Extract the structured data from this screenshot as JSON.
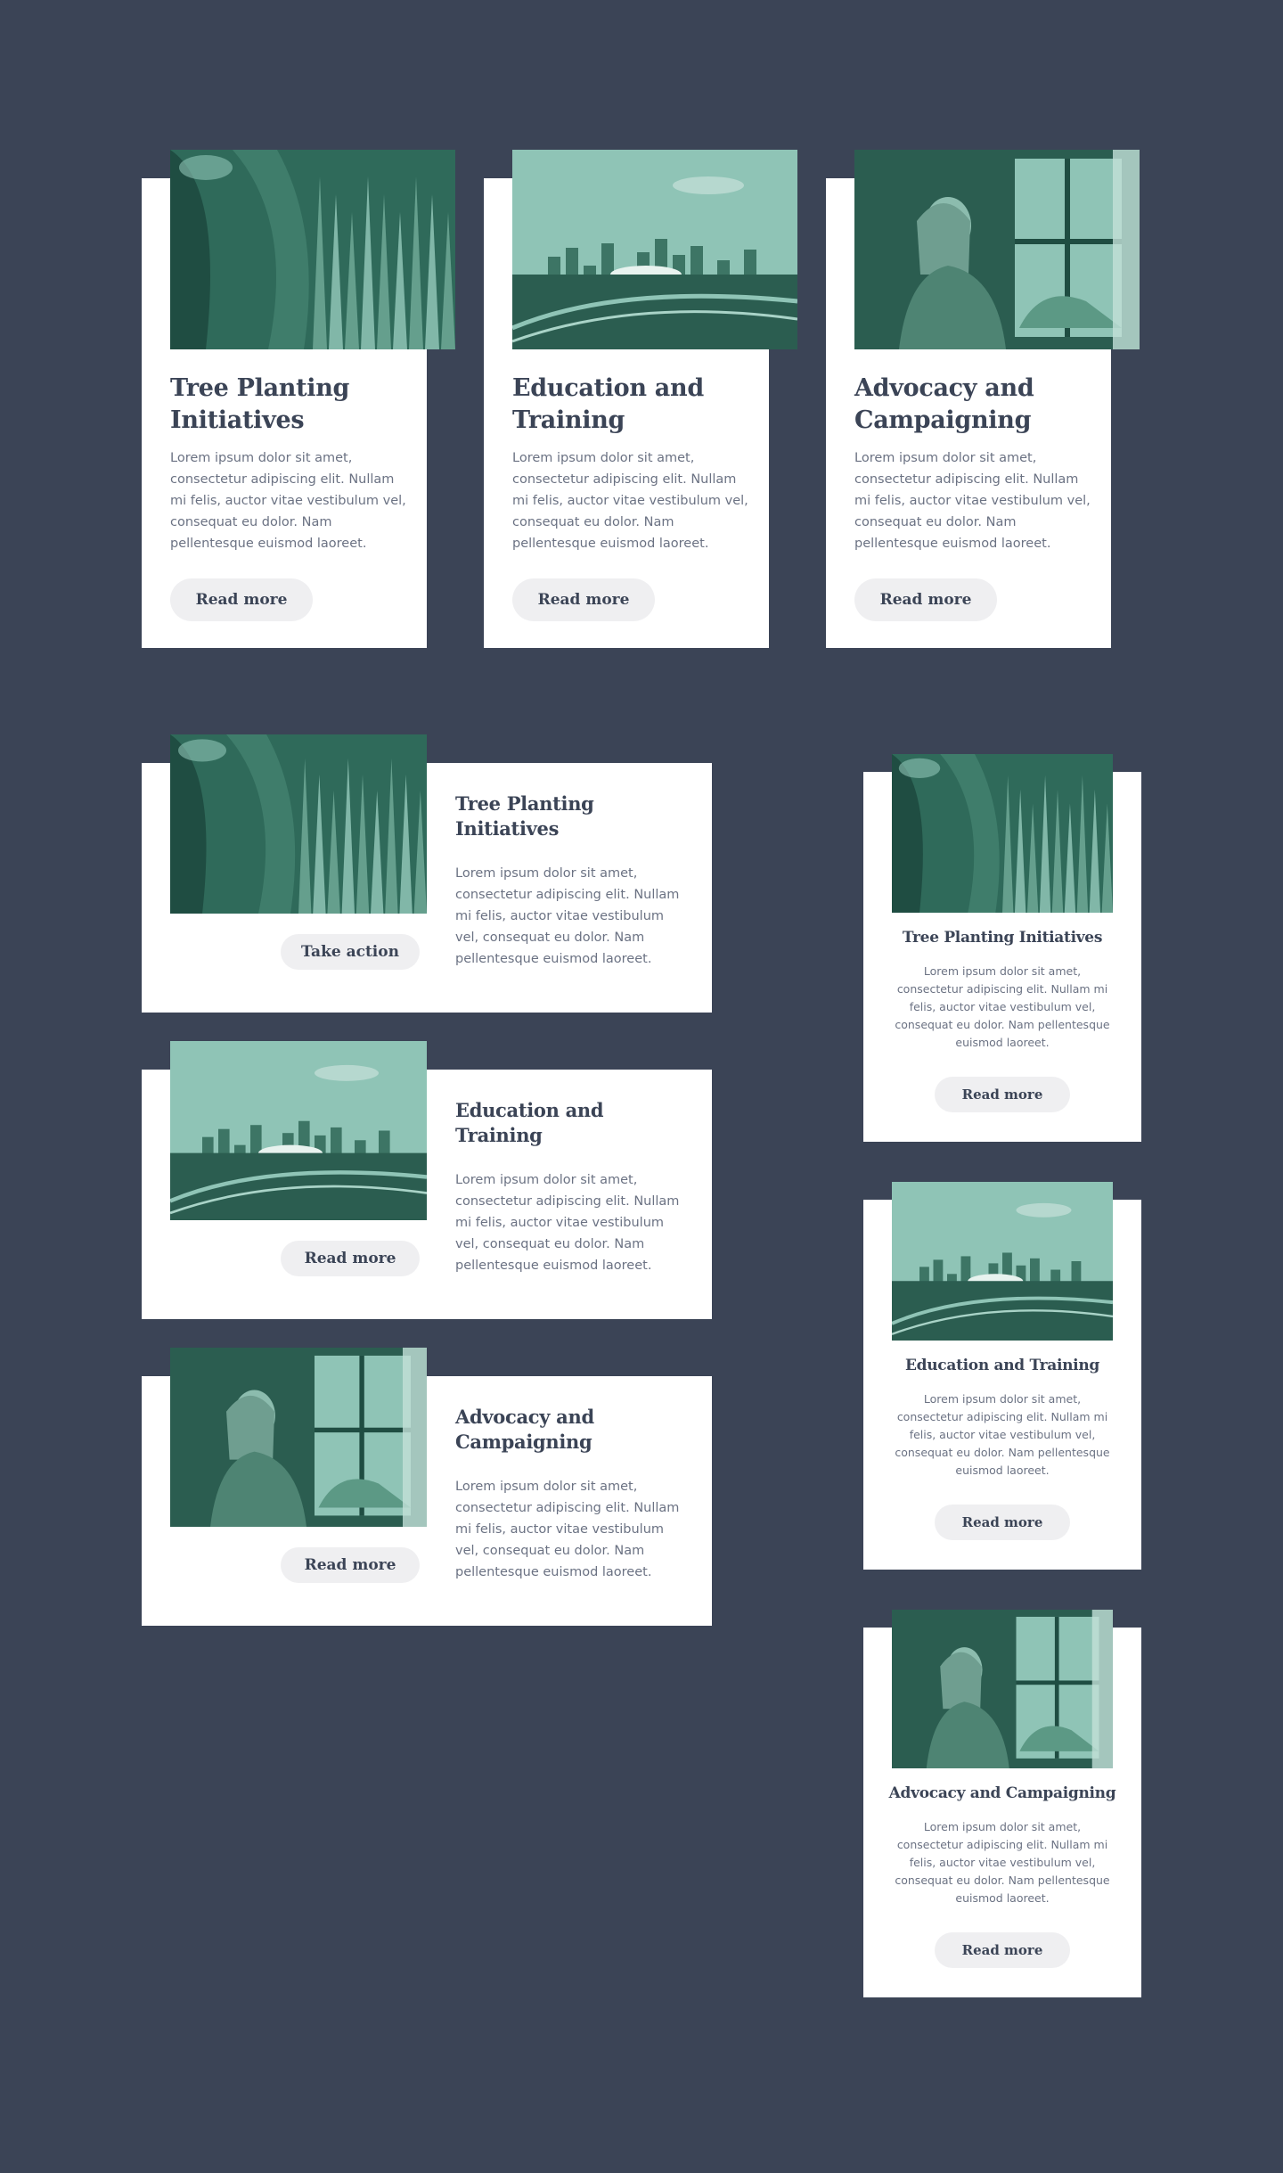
{
  "colors": {
    "page_background": "#3b4456",
    "card_background": "#ffffff",
    "heading_text": "#3b4456",
    "body_text": "#6b7283",
    "button_background": "#efeff1",
    "photo_tint_dark": "#1f4d42",
    "photo_tint_light": "#8fc4b6"
  },
  "top_row": {
    "cards": [
      {
        "image_icon": "plant-photo",
        "title": "Tree Planting Initiatives",
        "body": "Lorem ipsum dolor sit amet, consectetur adipiscing elit. Nullam mi felis, auctor vitae vestibulum vel, consequat eu dolor. Nam pellentesque euismod laoreet.",
        "button": "Read more"
      },
      {
        "image_icon": "city-skyline-photo",
        "title": "Education and Training",
        "body": "Lorem ipsum dolor sit amet, consectetur adipiscing elit. Nullam mi felis, auctor vitae vestibulum vel, consequat eu dolor. Nam pellentesque euismod laoreet.",
        "button": "Read more"
      },
      {
        "image_icon": "woman-window-photo",
        "title": "Advocacy and Campaigning",
        "body": "Lorem ipsum dolor sit amet, consectetur adipiscing elit. Nullam mi felis, auctor vitae vestibulum vel, consequat eu dolor. Nam pellentesque euismod laoreet.",
        "button": "Read more"
      }
    ]
  },
  "horizontal_list": {
    "cards": [
      {
        "image_icon": "plant-photo",
        "title": "Tree Planting Initiatives",
        "body": "Lorem ipsum dolor sit amet, consectetur adipiscing elit. Nullam mi felis, auctor vitae vestibulum vel, consequat eu dolor. Nam pellentesque euismod laoreet.",
        "button": "Take action"
      },
      {
        "image_icon": "city-skyline-photo",
        "title": "Education and Training",
        "body": "Lorem ipsum dolor sit amet, consectetur adipiscing elit. Nullam mi felis, auctor vitae vestibulum vel, consequat eu dolor. Nam pellentesque euismod laoreet.",
        "button": "Read more"
      },
      {
        "image_icon": "woman-window-photo",
        "title": "Advocacy and Campaigning",
        "body": "Lorem ipsum dolor sit amet, consectetur adipiscing elit. Nullam mi felis, auctor vitae vestibulum vel, consequat eu dolor. Nam pellentesque euismod laoreet.",
        "button": "Read more"
      }
    ]
  },
  "compact_column": {
    "cards": [
      {
        "image_icon": "plant-photo",
        "title": "Tree Planting Initiatives",
        "body": "Lorem ipsum dolor sit amet, consectetur adipiscing elit. Nullam mi felis, auctor vitae vestibulum vel, consequat eu dolor. Nam pellentesque euismod laoreet.",
        "button": "Read more"
      },
      {
        "image_icon": "city-skyline-photo",
        "title": "Education and Training",
        "body": "Lorem ipsum dolor sit amet, consectetur adipiscing elit. Nullam mi felis, auctor vitae vestibulum vel, consequat eu dolor. Nam pellentesque euismod laoreet.",
        "button": "Read more"
      },
      {
        "image_icon": "woman-window-photo",
        "title": "Advocacy and Campaigning",
        "body": "Lorem ipsum dolor sit amet, consectetur adipiscing elit. Nullam mi felis, auctor vitae vestibulum vel, consequat eu dolor. Nam pellentesque euismod laoreet.",
        "button": "Read more"
      }
    ]
  }
}
